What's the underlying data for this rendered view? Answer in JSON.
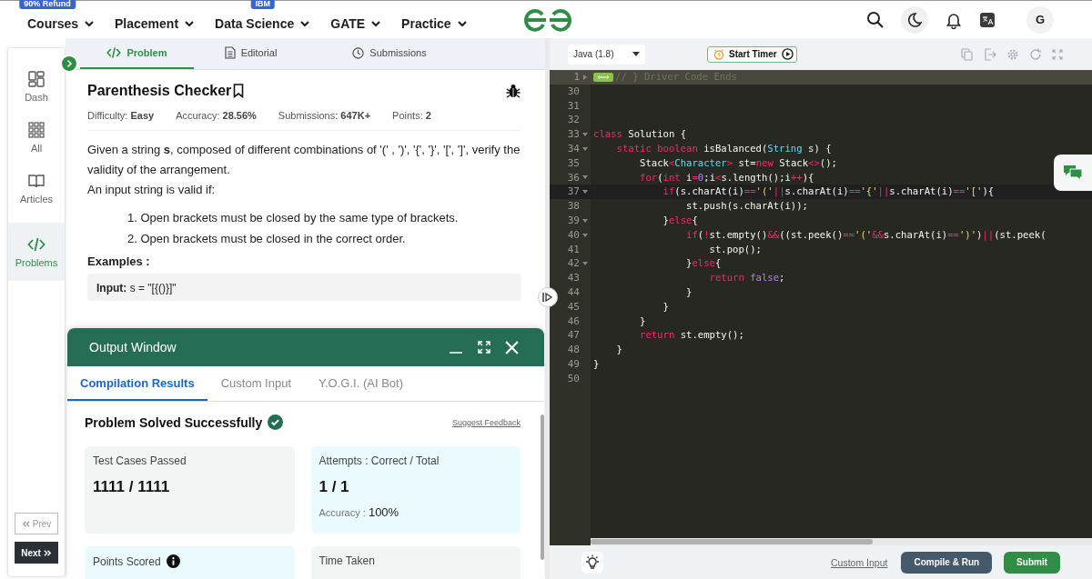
{
  "nav": {
    "items": [
      {
        "label": "Courses",
        "badge": "90% Refund"
      },
      {
        "label": "Placement"
      },
      {
        "label": "Data Science",
        "badge": "IBM"
      },
      {
        "label": "GATE"
      },
      {
        "label": "Practice"
      }
    ],
    "avatar": "G"
  },
  "sidebar": {
    "items": [
      {
        "label": "Dash",
        "selected": false
      },
      {
        "label": "All",
        "selected": false
      },
      {
        "label": "Articles",
        "selected": false
      },
      {
        "label": "Problems",
        "selected": true
      }
    ],
    "buttons": [
      {
        "label": "Prev",
        "kind": "prev",
        "disabled": true
      },
      {
        "label": "Next",
        "kind": "next",
        "disabled": false
      }
    ]
  },
  "problem_tabs": [
    {
      "label": "Problem",
      "selected": true
    },
    {
      "label": "Editorial",
      "selected": false
    },
    {
      "label": "Submissions",
      "selected": false
    }
  ],
  "problem": {
    "title": "Parenthesis Checker",
    "meta": [
      {
        "label": "Difficulty:",
        "value": "Easy"
      },
      {
        "label": "Accuracy:",
        "value": "28.56%"
      },
      {
        "label": "Submissions:",
        "value": "647K+"
      },
      {
        "label": "Points:",
        "value": "2"
      }
    ],
    "description": [
      "Given a string **s**, composed of different combinations of '(' , ')', '{', '}', '[', ']', verify the validity of the arrangement.",
      "An input string is valid if:"
    ],
    "rules": [
      "1. Open brackets must be closed by the same type of brackets.",
      "2. Open brackets must be closed in the correct order."
    ],
    "examples_heading": "Examples :",
    "example": {
      "label": "Input:",
      "value": "s = \"[{()}]\""
    }
  },
  "output": {
    "title": "Output Window",
    "tabs": [
      {
        "label": "Compilation Results",
        "selected": true
      },
      {
        "label": "Custom Input",
        "selected": false
      },
      {
        "label": "Y.O.G.I. (AI Bot)",
        "selected": false
      }
    ],
    "status": "Problem Solved Successfully",
    "solved": true,
    "feedback": "Suggest Feedback",
    "cards": [
      {
        "label": "Test Cases Passed",
        "value": "1111 / 1111",
        "color": "#f1f5f4"
      },
      {
        "label": "Attempts : Correct / Total",
        "value": "1 / 1",
        "extra_label": "Accuracy :",
        "extra_value": "100%",
        "color": "#eafaff"
      },
      {
        "label": "Points Scored",
        "info": true,
        "color": "#eafaff"
      },
      {
        "label": "Time Taken",
        "color": "#f1f5f4"
      }
    ]
  },
  "editor": {
    "language": "Java (1.8)",
    "timer": "Start Timer",
    "lines": [
      {
        "num": "1",
        "kind": "folded",
        "foldable": true,
        "active": false,
        "tokens": [
          {
            "kind": "comment",
            "text": "// } Driver Code Ends"
          }
        ]
      },
      {
        "num": "30",
        "kind": "code",
        "foldable": false,
        "active": false
      },
      {
        "num": "31",
        "kind": "code",
        "foldable": false,
        "active": false
      },
      {
        "num": "32",
        "kind": "code",
        "foldable": false,
        "active": false
      },
      {
        "num": "33",
        "kind": "code",
        "foldable": true,
        "active": false,
        "tokens": [
          {
            "kind": "kw",
            "text": "class"
          },
          {
            "kind": "plain",
            "text": " Solution {"
          }
        ]
      },
      {
        "num": "34",
        "kind": "code",
        "foldable": true,
        "active": false,
        "tokens": [
          {
            "kind": "kw",
            "text": "    static"
          },
          {
            "kind": "kw",
            "text": " boolean"
          },
          {
            "kind": "plain",
            "text": " isBalanced("
          },
          {
            "kind": "type",
            "text": "String"
          },
          {
            "kind": "plain",
            "text": " s) {"
          }
        ]
      },
      {
        "num": "35",
        "kind": "code",
        "foldable": false,
        "active": false,
        "tokens": [
          {
            "kind": "plain",
            "text": "        Stack"
          },
          {
            "kind": "op",
            "text": "<"
          },
          {
            "kind": "type",
            "text": "Character"
          },
          {
            "kind": "op",
            "text": ">"
          },
          {
            "kind": "plain",
            "text": " st="
          },
          {
            "kind": "kw",
            "text": "new"
          },
          {
            "kind": "plain",
            "text": " Stack"
          },
          {
            "kind": "op",
            "text": "<>"
          },
          {
            "kind": "plain",
            "text": "();"
          }
        ]
      },
      {
        "num": "36",
        "kind": "code",
        "foldable": true,
        "active": false,
        "tokens": [
          {
            "kind": "kw",
            "text": "        for"
          },
          {
            "kind": "plain",
            "text": "("
          },
          {
            "kind": "kw",
            "text": "int"
          },
          {
            "kind": "plain",
            "text": " i"
          },
          {
            "kind": "op",
            "text": "="
          },
          {
            "kind": "num",
            "text": "0"
          },
          {
            "kind": "plain",
            "text": ";i"
          },
          {
            "kind": "op",
            "text": "<"
          },
          {
            "kind": "plain",
            "text": "s.length();i"
          },
          {
            "kind": "op",
            "text": "++"
          },
          {
            "kind": "plain",
            "text": "){"
          }
        ]
      },
      {
        "num": "37",
        "kind": "code",
        "foldable": true,
        "active": true,
        "tokens": [
          {
            "kind": "kw",
            "text": "            if"
          },
          {
            "kind": "plain",
            "text": "(s.charAt(i)"
          },
          {
            "kind": "op",
            "text": "=="
          },
          {
            "kind": "str",
            "text": "'('"
          },
          {
            "kind": "op",
            "text": "||"
          },
          {
            "kind": "plain",
            "text": "s.charAt(i)"
          },
          {
            "kind": "op",
            "text": "=="
          },
          {
            "kind": "str",
            "text": "'{'"
          },
          {
            "kind": "op",
            "text": "||"
          },
          {
            "kind": "plain",
            "text": "s.charAt(i)"
          },
          {
            "kind": "op",
            "text": "=="
          },
          {
            "kind": "str",
            "text": "'['"
          },
          {
            "kind": "plain",
            "text": "){"
          }
        ]
      },
      {
        "num": "38",
        "kind": "code",
        "foldable": false,
        "active": false,
        "tokens": [
          {
            "kind": "plain",
            "text": "                st.push(s.charAt(i));"
          }
        ]
      },
      {
        "num": "39",
        "kind": "code",
        "foldable": true,
        "active": false,
        "tokens": [
          {
            "kind": "plain",
            "text": "            }"
          },
          {
            "kind": "kw",
            "text": "else"
          },
          {
            "kind": "plain",
            "text": "{"
          }
        ]
      },
      {
        "num": "40",
        "kind": "code",
        "foldable": true,
        "active": false,
        "tokens": [
          {
            "kind": "kw",
            "text": "                if"
          },
          {
            "kind": "plain",
            "text": "("
          },
          {
            "kind": "op",
            "text": "!"
          },
          {
            "kind": "plain",
            "text": "st.empty()"
          },
          {
            "kind": "op",
            "text": "&&"
          },
          {
            "kind": "plain",
            "text": "((st.peek()"
          },
          {
            "kind": "op",
            "text": "=="
          },
          {
            "kind": "str",
            "text": "'('"
          },
          {
            "kind": "op",
            "text": "&&"
          },
          {
            "kind": "plain",
            "text": "s.charAt(i)"
          },
          {
            "kind": "op",
            "text": "=="
          },
          {
            "kind": "str",
            "text": "')'"
          },
          {
            "kind": "plain",
            "text": ")"
          },
          {
            "kind": "op",
            "text": "||"
          },
          {
            "kind": "plain",
            "text": "(st.peek("
          }
        ]
      },
      {
        "num": "41",
        "kind": "code",
        "foldable": false,
        "active": false,
        "tokens": [
          {
            "kind": "plain",
            "text": "                    st.pop();"
          }
        ]
      },
      {
        "num": "42",
        "kind": "code",
        "foldable": true,
        "active": false,
        "tokens": [
          {
            "kind": "plain",
            "text": "                }"
          },
          {
            "kind": "kw",
            "text": "else"
          },
          {
            "kind": "plain",
            "text": "{"
          }
        ]
      },
      {
        "num": "43",
        "kind": "code",
        "foldable": false,
        "active": false,
        "tokens": [
          {
            "kind": "kw",
            "text": "                    return"
          },
          {
            "kind": "const",
            "text": " false"
          },
          {
            "kind": "plain",
            "text": ";"
          }
        ]
      },
      {
        "num": "44",
        "kind": "code",
        "foldable": false,
        "active": false,
        "tokens": [
          {
            "kind": "plain",
            "text": "                }"
          }
        ]
      },
      {
        "num": "45",
        "kind": "code",
        "foldable": false,
        "active": false,
        "tokens": [
          {
            "kind": "plain",
            "text": "            }"
          }
        ]
      },
      {
        "num": "46",
        "kind": "code",
        "foldable": false,
        "active": false,
        "tokens": [
          {
            "kind": "plain",
            "text": "        }"
          }
        ]
      },
      {
        "num": "47",
        "kind": "code",
        "foldable": false,
        "active": false,
        "tokens": [
          {
            "kind": "kw",
            "text": "        return"
          },
          {
            "kind": "plain",
            "text": " st.empty();"
          }
        ]
      },
      {
        "num": "48",
        "kind": "code",
        "foldable": false,
        "active": false,
        "tokens": [
          {
            "kind": "plain",
            "text": "    }"
          }
        ]
      },
      {
        "num": "49",
        "kind": "code",
        "foldable": false,
        "active": false,
        "tokens": [
          {
            "kind": "plain",
            "text": "}"
          }
        ]
      },
      {
        "num": "50",
        "kind": "code",
        "foldable": false,
        "active": false
      }
    ],
    "custom_input": "Custom Input",
    "compile": "Compile & Run",
    "submit": "Submit"
  }
}
